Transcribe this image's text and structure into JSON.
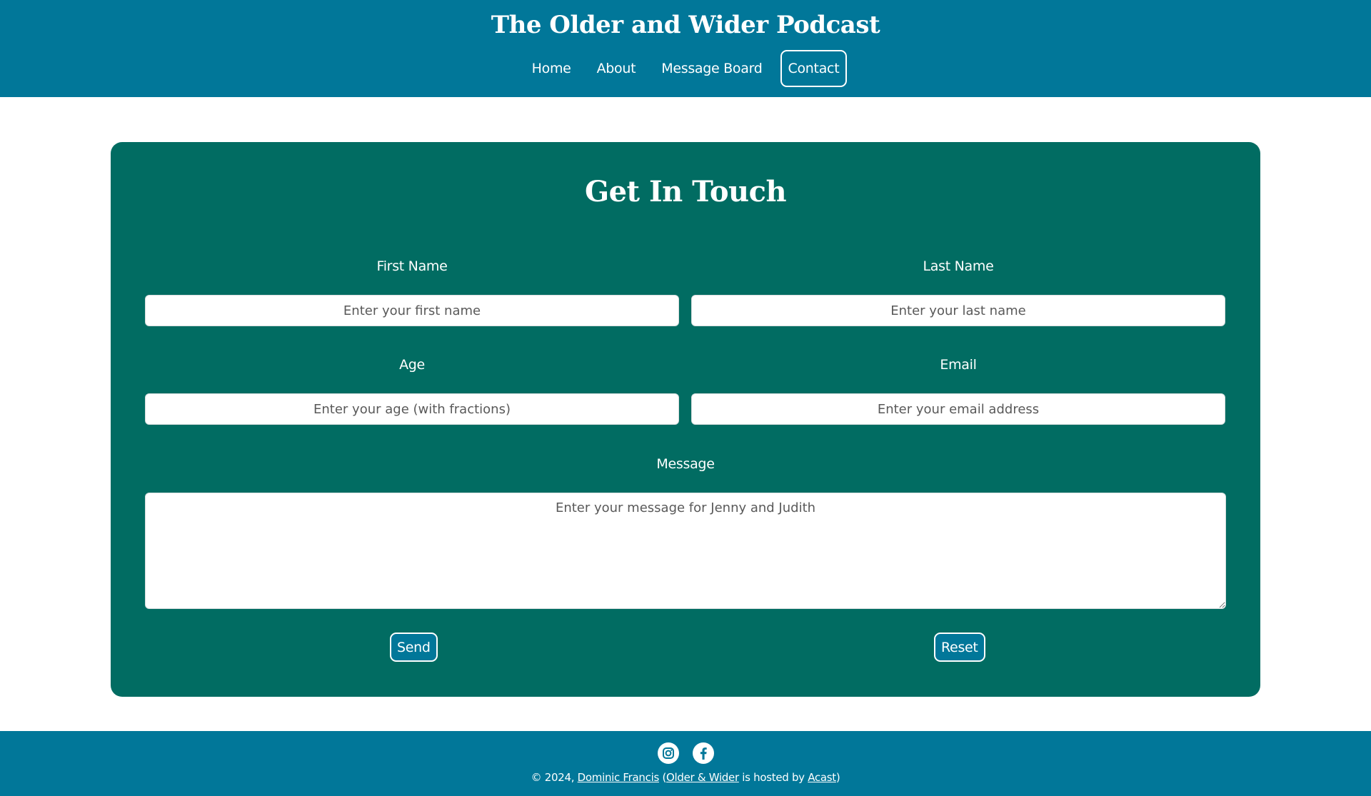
{
  "header": {
    "title": "The Older and Wider Podcast",
    "nav": [
      {
        "label": "Home",
        "active": false
      },
      {
        "label": "About",
        "active": false
      },
      {
        "label": "Message Board",
        "active": false
      },
      {
        "label": "Contact",
        "active": true
      }
    ]
  },
  "form": {
    "title": "Get In Touch",
    "first_name": {
      "label": "First Name",
      "placeholder": "Enter your first name",
      "value": ""
    },
    "last_name": {
      "label": "Last Name",
      "placeholder": "Enter your last name",
      "value": ""
    },
    "age": {
      "label": "Age",
      "placeholder": "Enter your age (with fractions)",
      "value": ""
    },
    "email": {
      "label": "Email",
      "placeholder": "Enter your email address",
      "value": ""
    },
    "message": {
      "label": "Message",
      "placeholder": "Enter your message for Jenny and Judith",
      "value": ""
    },
    "send_label": "Send",
    "reset_label": "Reset"
  },
  "footer": {
    "social_icons": [
      "instagram-icon",
      "facebook-icon"
    ],
    "copyright_prefix": "© 2024, ",
    "author_link": "Dominic Francis",
    "open_paren": " (",
    "podcast_link": "Older & Wider",
    "hosted_text": " is hosted by ",
    "host_link": "Acast",
    "close_paren": ")"
  },
  "colors": {
    "header_bg": "#017799",
    "card_bg": "#016c62",
    "page_bg": "#ffffff",
    "text_light": "#ffffff"
  }
}
